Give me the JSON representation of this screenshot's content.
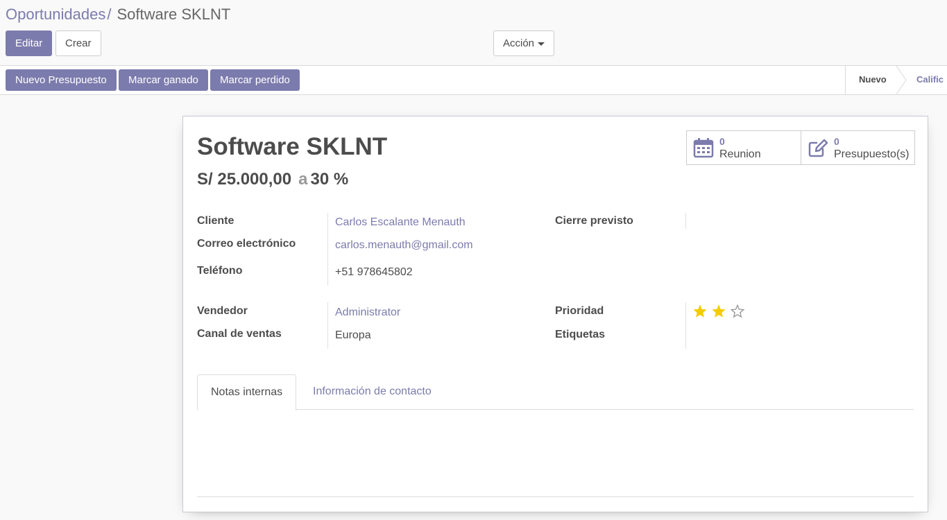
{
  "breadcrumb": {
    "parent": "Oportunidades",
    "separator": "/",
    "current": "Software SKLNT"
  },
  "toolbar": {
    "edit_label": "Editar",
    "create_label": "Crear",
    "action_label": "Acción"
  },
  "statusbar": {
    "buttons": [
      {
        "label": "Nuevo Presupuesto"
      },
      {
        "label": "Marcar ganado"
      },
      {
        "label": "Marcar perdido"
      }
    ],
    "stages": [
      {
        "label": "Nuevo",
        "active": true
      },
      {
        "label": "Calific",
        "active": false
      }
    ]
  },
  "record": {
    "name": "Software SKLNT",
    "revenue": "S/ 25.000,00",
    "at_word": "a",
    "probability": "30 %"
  },
  "smart_buttons": [
    {
      "count": "0",
      "label": "Reunion",
      "icon": "calendar-icon"
    },
    {
      "count": "0",
      "label": "Presupuesto(s)",
      "icon": "edit-icon"
    }
  ],
  "fields": {
    "customer_label": "Cliente",
    "customer_value": "Carlos Escalante Menauth",
    "email_label": "Correo electrónico",
    "email_value": "carlos.menauth@gmail.com",
    "phone_label": "Teléfono",
    "phone_value": "+51 978645802",
    "expected_close_label": "Cierre previsto",
    "expected_close_value": "",
    "salesperson_label": "Vendedor",
    "salesperson_value": "Administrator",
    "sales_channel_label": "Canal de ventas",
    "sales_channel_value": "Europa",
    "priority_label": "Prioridad",
    "priority_stars": 2,
    "priority_max": 3,
    "tags_label": "Etiquetas"
  },
  "tabs": [
    {
      "label": "Notas internas",
      "active": true
    },
    {
      "label": "Información de contacto",
      "active": false
    }
  ],
  "colors": {
    "brand": "#7c7bad",
    "star": "#f3cc00",
    "text": "#4c4c4c"
  }
}
